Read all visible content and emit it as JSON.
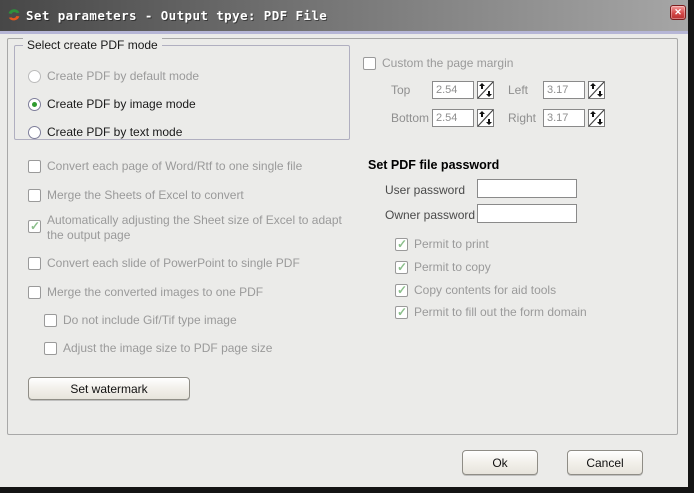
{
  "window": {
    "title": "Set parameters - Output tpye: PDF File",
    "close_glyph": "✕"
  },
  "mode_group": {
    "title": "Select create PDF mode",
    "options": [
      {
        "label": "Create PDF by default mode",
        "state": "disabled"
      },
      {
        "label": "Create PDF by image mode",
        "state": "selected"
      },
      {
        "label": "Create PDF by text mode",
        "state": "unselected"
      }
    ]
  },
  "conversion_options": [
    {
      "label": "Convert each page of Word/Rtf to one single file",
      "checked": false
    },
    {
      "label": "Merge the Sheets of Excel to convert",
      "checked": false
    },
    {
      "label": "Automatically adjusting the Sheet size of Excel to adapt the output page",
      "checked": true
    },
    {
      "label": "Convert each slide of PowerPoint to single PDF",
      "checked": false
    },
    {
      "label": "Merge the converted images to one PDF",
      "checked": false
    },
    {
      "label": "Do not include Gif/Tif type image",
      "checked": false
    },
    {
      "label": "Adjust the image size to PDF page size",
      "checked": false
    }
  ],
  "watermark_button": "Set watermark",
  "margin_section": {
    "checkbox_label": "Custom the page margin",
    "checked": false,
    "fields": [
      {
        "label": "Top",
        "value": "2.54"
      },
      {
        "label": "Left",
        "value": "3.17"
      },
      {
        "label": "Bottom",
        "value": "2.54"
      },
      {
        "label": "Right",
        "value": "3.17"
      }
    ]
  },
  "password_section": {
    "title": "Set PDF file password",
    "user_label": "User password",
    "user_value": "",
    "owner_label": "Owner password",
    "owner_value": "",
    "permissions": [
      {
        "label": "Permit to print",
        "checked": true
      },
      {
        "label": "Permit to copy",
        "checked": true
      },
      {
        "label": "Copy contents for aid tools",
        "checked": true
      },
      {
        "label": "Permit to fill out the form domain",
        "checked": true
      }
    ]
  },
  "footer": {
    "ok": "Ok",
    "cancel": "Cancel"
  },
  "colors": {
    "titlebar_dark": "#474747",
    "titlebar_light": "#a6a6a6",
    "accent_strip": "#b6b6d6",
    "check_green": "#8bbf8b",
    "radio_green": "#2f9b2f",
    "close_red": "#d44a4a"
  }
}
